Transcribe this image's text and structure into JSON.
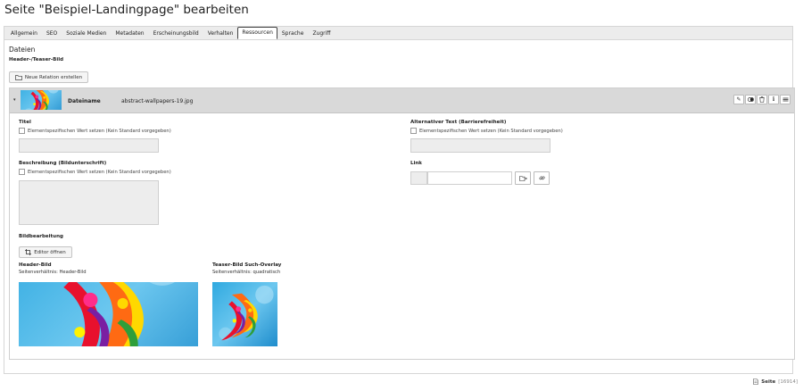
{
  "page": {
    "title": "Seite \"Beispiel-Landingpage\" bearbeiten"
  },
  "tabs": [
    {
      "label": "Allgemein"
    },
    {
      "label": "SEO"
    },
    {
      "label": "Soziale Medien"
    },
    {
      "label": "Metadaten"
    },
    {
      "label": "Erscheinungsbild"
    },
    {
      "label": "Verhalten"
    },
    {
      "label": "Ressourcen",
      "active": true
    },
    {
      "label": "Sprache"
    },
    {
      "label": "Zugriff"
    }
  ],
  "section": {
    "title": "Dateien",
    "field_title": "Header-/Teaser-Bild",
    "new_relation_label": "Neue Relation erstellen"
  },
  "relation": {
    "filename_label": "Dateiname",
    "filename_value": "abstract-wallpapers-19.jpg",
    "controls": [
      "pencil-icon",
      "toggle-icon",
      "trash-icon",
      "info-icon",
      "drag-handle-icon"
    ]
  },
  "fields": {
    "titel_label": "Titel",
    "beschreibung_label": "Beschreibung (Bildunterschrift)",
    "alt_label": "Alternativer Text (Barrierefreiheit)",
    "link_label": "Link",
    "override_label": "Elementspezifischen Wert setzen (Kein Standard vorgegeben)"
  },
  "crop": {
    "section_label": "Bildbearbeitung",
    "editor_button": "Editor öffnen",
    "header": {
      "title": "Header-Bild",
      "ratio": "Seitenverhältnis: Header-Bild"
    },
    "teaser": {
      "title": "Teaser-Bild Such-Overlay",
      "ratio": "Seitenverhältnis: quadratisch"
    }
  },
  "footer": {
    "label": "Seite",
    "id": "[16914]"
  },
  "colors": {
    "header_bg": "#d9d9d9",
    "input_bg": "#ededed",
    "tab_bar_bg": "#ececec"
  }
}
